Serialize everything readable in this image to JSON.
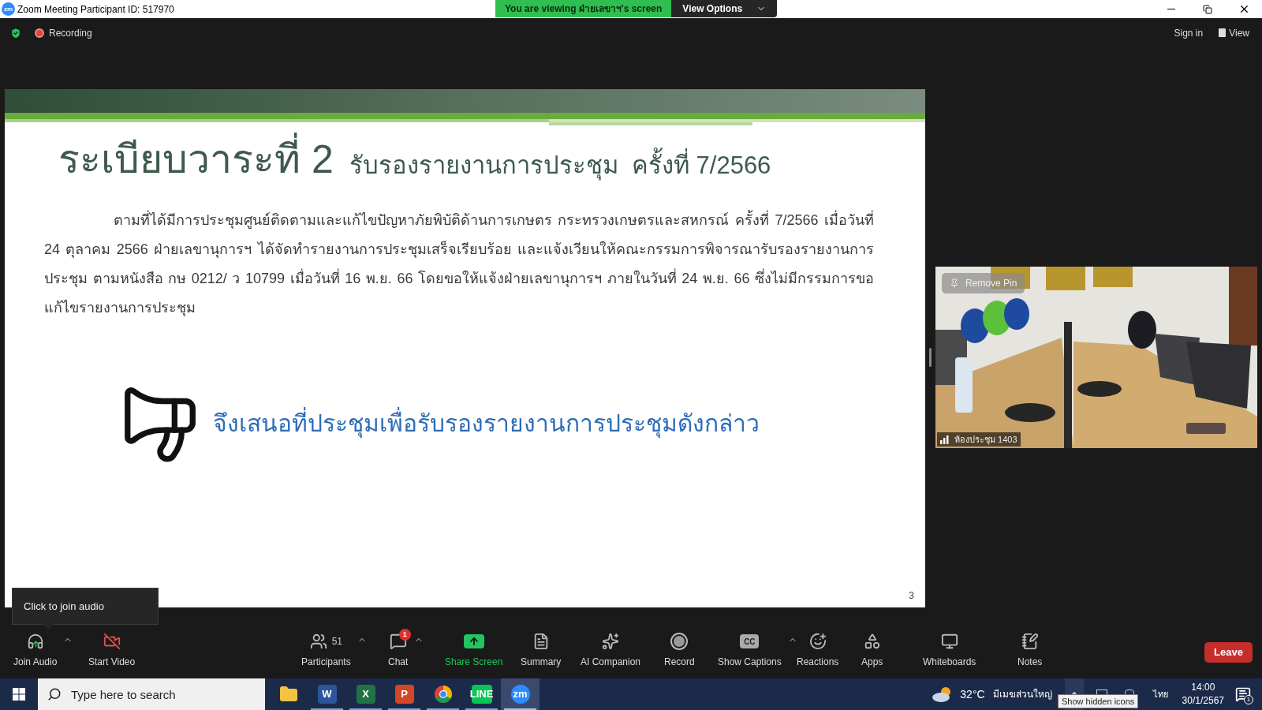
{
  "window": {
    "logo": "zm",
    "title": "Zoom Meeting Participant ID: 517970"
  },
  "share_banner": {
    "text": "You are viewing ฝ่ายเลขาฯ's screen",
    "button": "View Options"
  },
  "header": {
    "recording": "Recording",
    "sign_in": "Sign in",
    "view": "View"
  },
  "slide": {
    "title": "ระเบียบวาระที่ 2",
    "subtitle": "รับรองรายงานการประชุม  ครั้งที่ 7/2566",
    "paragraph": "ตามที่ได้มีการประชุมศูนย์ติดตามและแก้ไขปัญหาภัยพิบัติด้านการเกษตร กระทรวงเกษตรและสหกรณ์ ครั้งที่ 7/2566 เมื่อวันที่ 24 ตุลาคม 2566 ฝ่ายเลขานุการฯ ได้จัดทำรายงานการประชุมเสร็จเรียบร้อย และแจ้งเวียนให้คณะกรรมการพิจารณารับรองรายงานการประชุม ตามหนังสือ กษ 0212/ ว 10799 เมื่อวันที่ 16 พ.ย. 66 โดยขอให้แจ้งฝ่ายเลขานุการฯ ภายในวันที่ 24 พ.ย. 66 ซึ่งไม่มีกรรมการขอแก้ไขรายงานการประชุม",
    "proposal": "จึงเสนอที่ประชุมเพื่อรับรองรายงานการประชุมดังกล่าว",
    "page": "3"
  },
  "video": {
    "remove_pin": "Remove Pin",
    "name": "ห้องประชุม 1403"
  },
  "tooltip": "Click to join audio",
  "toolbar": [
    {
      "label": "Join Audio",
      "caret": true,
      "highlighted": false
    },
    {
      "label": "Start Video",
      "caret": false,
      "highlighted": false
    },
    {
      "label": "Participants",
      "count": "51",
      "caret": true,
      "highlighted": false
    },
    {
      "label": "Chat",
      "badge": "1",
      "caret": true,
      "highlighted": false
    },
    {
      "label": "Share Screen",
      "caret": false,
      "highlighted": true
    },
    {
      "label": "Summary",
      "caret": false,
      "highlighted": false
    },
    {
      "label": "AI Companion",
      "caret": false,
      "highlighted": false
    },
    {
      "label": "Record",
      "caret": false,
      "highlighted": false
    },
    {
      "label": "Show Captions",
      "icon_text": "CC",
      "caret": true,
      "highlighted": false
    },
    {
      "label": "Reactions",
      "caret": false,
      "highlighted": false
    },
    {
      "label": "Apps",
      "caret": false,
      "highlighted": false
    },
    {
      "label": "Whiteboards",
      "caret": false,
      "highlighted": false
    },
    {
      "label": "Notes",
      "caret": false,
      "highlighted": false
    }
  ],
  "leave": "Leave",
  "taskbar": {
    "search_placeholder": "Type here to search",
    "apps": [
      {
        "running": false,
        "active": false
      },
      {
        "label": "W",
        "running": true,
        "active": false
      },
      {
        "label": "X",
        "running": true,
        "active": false
      },
      {
        "label": "P",
        "running": true,
        "active": false
      },
      {
        "running": true,
        "active": false
      },
      {
        "label": "LINE",
        "running": true,
        "active": false
      },
      {
        "label": "zm",
        "running": true,
        "active": true
      }
    ],
    "temperature": "32°C",
    "weather": "มีเมฆส่วนใหญ่",
    "language": "ไทย",
    "time": "14:00",
    "date": "30/1/2567",
    "notifications": "1",
    "tooltip": "Show hidden icons"
  }
}
